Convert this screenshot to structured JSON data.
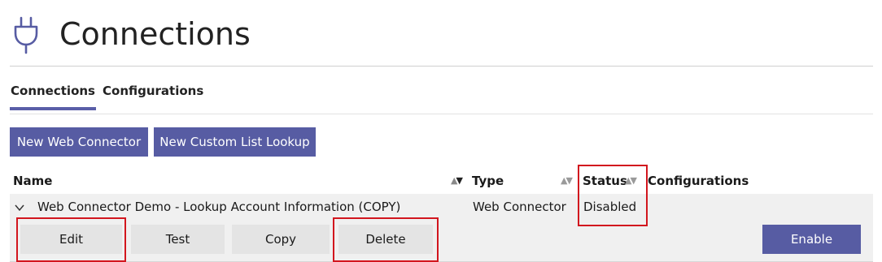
{
  "page": {
    "title": "Connections",
    "icon": "plug-icon",
    "accent_color": "#575ca3",
    "highlight_color": "#d2161e"
  },
  "tabs": [
    {
      "label": "Connections",
      "active": true
    },
    {
      "label": "Configurations",
      "active": false
    }
  ],
  "toolbar": {
    "new_web_connector": "New Web Connector",
    "new_custom_list_lookup": "New Custom List Lookup"
  },
  "table": {
    "columns": {
      "name": "Name",
      "type": "Type",
      "status": "Status",
      "configurations": "Configurations"
    },
    "rows": [
      {
        "expanded": true,
        "name": "Web Connector Demo - Lookup Account Information (COPY)",
        "type": "Web Connector",
        "status": "Disabled",
        "configurations": "",
        "actions": {
          "edit": "Edit",
          "test": "Test",
          "copy": "Copy",
          "delete": "Delete",
          "enable": "Enable"
        }
      }
    ]
  }
}
